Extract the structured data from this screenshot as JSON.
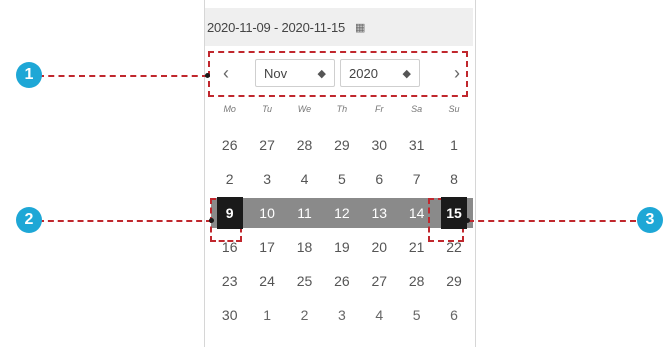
{
  "range_text": "2020-11-09 - 2020-11-15",
  "nav": {
    "prev": "‹",
    "next": "›",
    "month": "Nov",
    "year": "2020",
    "select_arrows": "◆"
  },
  "weekdays": [
    "Mo",
    "Tu",
    "We",
    "Th",
    "Fr",
    "Sa",
    "Su"
  ],
  "weeks": [
    [
      "26",
      "27",
      "28",
      "29",
      "30",
      "31",
      "1"
    ],
    [
      "2",
      "3",
      "4",
      "5",
      "6",
      "7",
      "8"
    ],
    [
      "9",
      "10",
      "11",
      "12",
      "13",
      "14",
      "15"
    ],
    [
      "16",
      "17",
      "18",
      "19",
      "20",
      "21",
      "22"
    ],
    [
      "23",
      "24",
      "25",
      "26",
      "27",
      "28",
      "29"
    ],
    [
      "30",
      "1",
      "2",
      "3",
      "4",
      "5",
      "6"
    ]
  ],
  "callouts": [
    "1",
    "2",
    "3"
  ],
  "colors": {
    "accent_badge": "#1ea7d6",
    "callout_dash": "#c0272d",
    "range_band": "#8a8a8a",
    "endpoint": "#1a1a1a"
  }
}
